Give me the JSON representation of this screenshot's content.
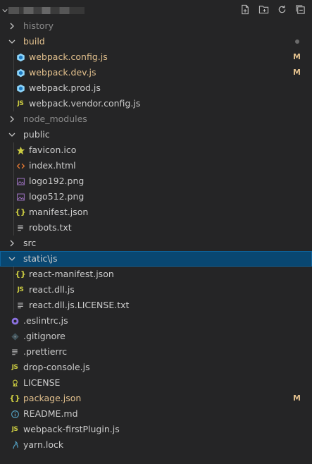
{
  "explorer": {
    "actions": [
      {
        "name": "new-file-icon"
      },
      {
        "name": "new-folder-icon"
      },
      {
        "name": "refresh-icon"
      },
      {
        "name": "collapse-all-icon"
      }
    ]
  },
  "tree": [
    {
      "label": "history",
      "folder": true,
      "open": false,
      "depth": 0,
      "dim": true
    },
    {
      "label": "build",
      "folder": true,
      "open": true,
      "depth": 0,
      "modified": true,
      "dot": true
    },
    {
      "label": "webpack.config.js",
      "depth": 1,
      "icon": "webpack",
      "modified": true,
      "badge": "M"
    },
    {
      "label": "webpack.dev.js",
      "depth": 1,
      "icon": "webpack",
      "modified": true,
      "badge": "M"
    },
    {
      "label": "webpack.prod.js",
      "depth": 1,
      "icon": "webpack"
    },
    {
      "label": "webpack.vendor.config.js",
      "depth": 1,
      "icon": "js"
    },
    {
      "label": "node_modules",
      "folder": true,
      "open": false,
      "depth": 0,
      "dim": true
    },
    {
      "label": "public",
      "folder": true,
      "open": true,
      "depth": 0
    },
    {
      "label": "favicon.ico",
      "depth": 1,
      "icon": "star"
    },
    {
      "label": "index.html",
      "depth": 1,
      "icon": "html"
    },
    {
      "label": "logo192.png",
      "depth": 1,
      "icon": "image"
    },
    {
      "label": "logo512.png",
      "depth": 1,
      "icon": "image"
    },
    {
      "label": "manifest.json",
      "depth": 1,
      "icon": "json"
    },
    {
      "label": "robots.txt",
      "depth": 1,
      "icon": "txt"
    },
    {
      "label": "src",
      "folder": true,
      "open": false,
      "depth": 0
    },
    {
      "label": "static\\js",
      "folder": true,
      "open": true,
      "depth": 0,
      "selected": true
    },
    {
      "label": "react-manifest.json",
      "depth": 1,
      "icon": "json"
    },
    {
      "label": "react.dll.js",
      "depth": 1,
      "icon": "js"
    },
    {
      "label": "react.dll.js.LICENSE.txt",
      "depth": 1,
      "icon": "txt"
    },
    {
      "label": ".eslintrc.js",
      "depth": 0,
      "icon": "eslint"
    },
    {
      "label": ".gitignore",
      "depth": 0,
      "icon": "git"
    },
    {
      "label": ".prettierrc",
      "depth": 0,
      "icon": "txt"
    },
    {
      "label": "drop-console.js",
      "depth": 0,
      "icon": "js"
    },
    {
      "label": "LICENSE",
      "depth": 0,
      "icon": "license"
    },
    {
      "label": "package.json",
      "depth": 0,
      "icon": "json",
      "modified": true,
      "badge": "M"
    },
    {
      "label": "README.md",
      "depth": 0,
      "icon": "info"
    },
    {
      "label": "webpack-firstPlugin.js",
      "depth": 0,
      "icon": "js"
    },
    {
      "label": "yarn.lock",
      "depth": 0,
      "icon": "yarn"
    }
  ],
  "colors": {
    "background": "#252526",
    "selected": "#094771",
    "modified": "#e2c08d",
    "js": "#cbcb41",
    "webpack": "#519aba",
    "html": "#e37933",
    "eslint": "#8b71e0"
  }
}
